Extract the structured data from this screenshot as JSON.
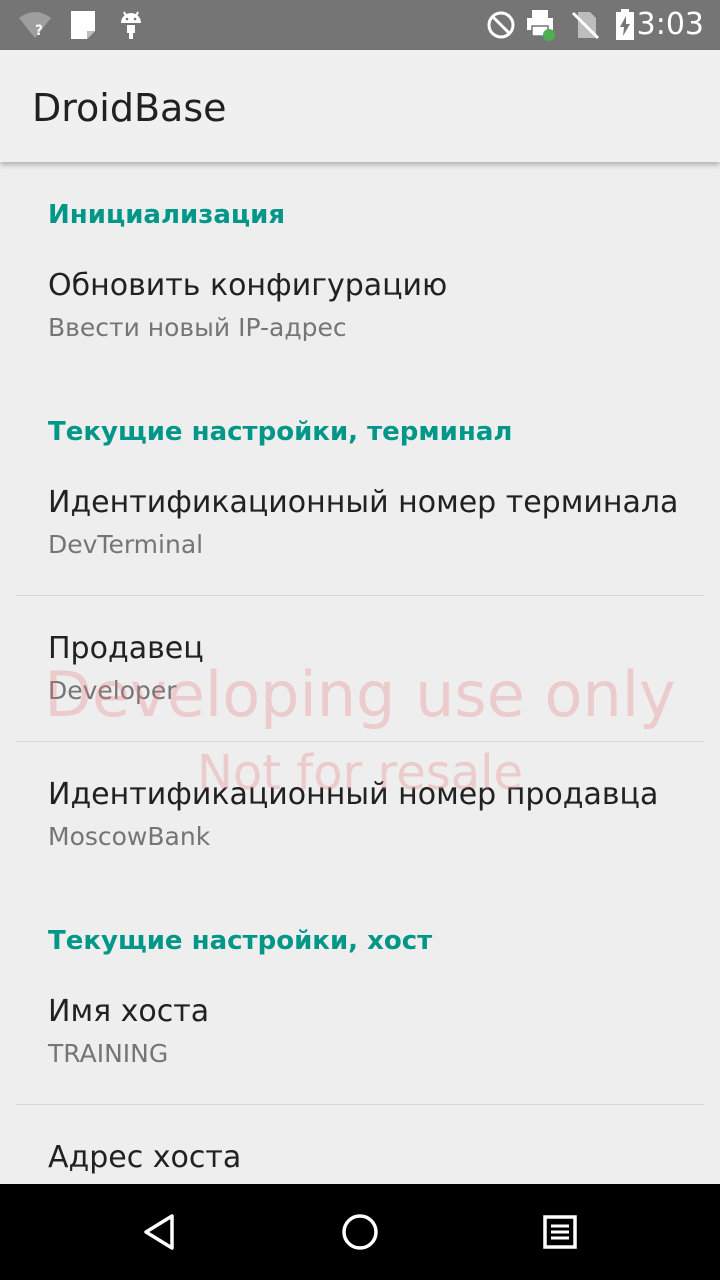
{
  "status_bar": {
    "time": "3:03",
    "icons": [
      "wifi-question-icon",
      "notification-card-icon",
      "android-icon",
      "do-not-disturb-icon",
      "printer-icon",
      "no-sim-icon",
      "battery-charging-icon"
    ]
  },
  "app_bar": {
    "title": "DroidBase"
  },
  "sections": {
    "init": {
      "header": "Инициализация",
      "items": [
        {
          "title": "Обновить конфигурацию",
          "summary": "Ввести новый IP-адрес"
        }
      ]
    },
    "terminal": {
      "header": "Текущие настройки, терминал",
      "items": [
        {
          "title": "Идентификационный номер терминала",
          "summary": "DevTerminal"
        },
        {
          "title": "Продавец",
          "summary": "Developer"
        },
        {
          "title": "Идентификационный номер продавца",
          "summary": "MoscowBank"
        }
      ]
    },
    "host": {
      "header": "Текущие настройки, хост",
      "items": [
        {
          "title": "Имя хоста",
          "summary": "TRAINING"
        },
        {
          "title": "Адрес хоста",
          "summary": ""
        }
      ]
    }
  },
  "watermark": {
    "line1": "Developing use only",
    "line2": "Not for resale"
  },
  "nav_bar": {
    "buttons": [
      "back-icon",
      "home-icon",
      "recents-icon"
    ]
  },
  "colors": {
    "accent": "#009688",
    "status_bar": "#757575",
    "app_bar": "#f0f0f0",
    "background": "#eeeeee",
    "watermark": "#e57373"
  }
}
